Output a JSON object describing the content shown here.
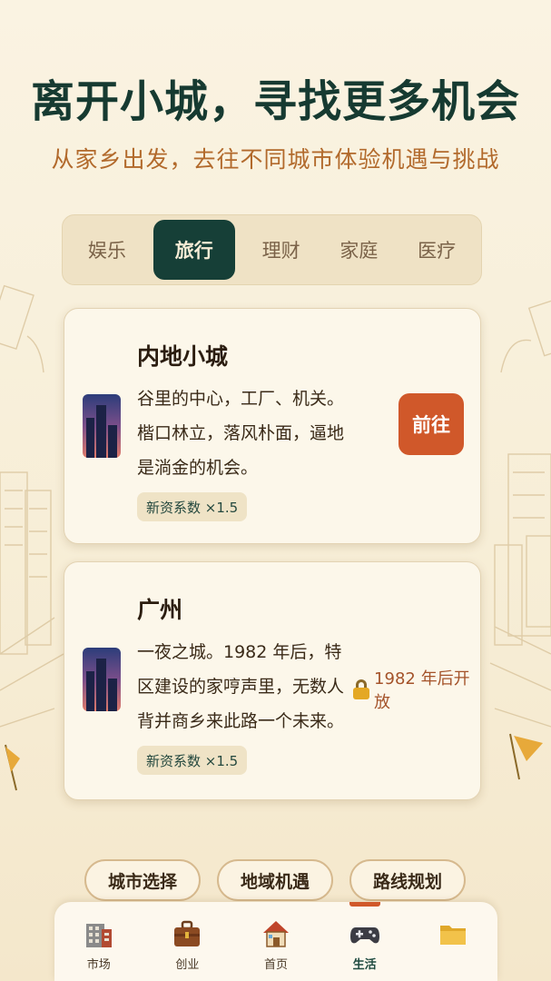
{
  "header": {
    "title": "离开小城，寻找更多机会",
    "subtitle": "从家乡出发，去往不同城市体验机遇与挑战"
  },
  "tabs": [
    {
      "label": "娱乐",
      "active": false
    },
    {
      "label": "旅行",
      "active": true
    },
    {
      "label": "理财",
      "active": false
    },
    {
      "label": "家庭",
      "active": false
    },
    {
      "label": "医疗",
      "active": false
    }
  ],
  "cities": [
    {
      "name": "内地小城",
      "description": "谷里的中心，工厂、机关。楷口林立，落风朴面，逼地是淌金的机会。",
      "badge": "新资系数 ×1.5",
      "action": "前往"
    },
    {
      "name": "广州",
      "description": "一夜之城。1982 年后，特区建设的家哼声里，无数人背并商乡来此路一个未来。",
      "badge": "新资系数 ×1.5",
      "locked_text": "1982 年后开放"
    }
  ],
  "pills": [
    "城市选择",
    "地域机遇",
    "路线规划"
  ],
  "nav": [
    {
      "label": "市场",
      "icon": "market-building-icon",
      "active": false
    },
    {
      "label": "创业",
      "icon": "briefcase-icon",
      "active": false
    },
    {
      "label": "首页",
      "icon": "home-icon",
      "active": false
    },
    {
      "label": "生活",
      "icon": "gamepad-icon",
      "active": true
    },
    {
      "label": "",
      "icon": "folder-icon",
      "active": false
    }
  ],
  "colors": {
    "title": "#163a31",
    "subtitle": "#b26a2c",
    "active_tab": "#163f37",
    "go_button": "#d0582a",
    "locked_text": "#a4532a"
  }
}
